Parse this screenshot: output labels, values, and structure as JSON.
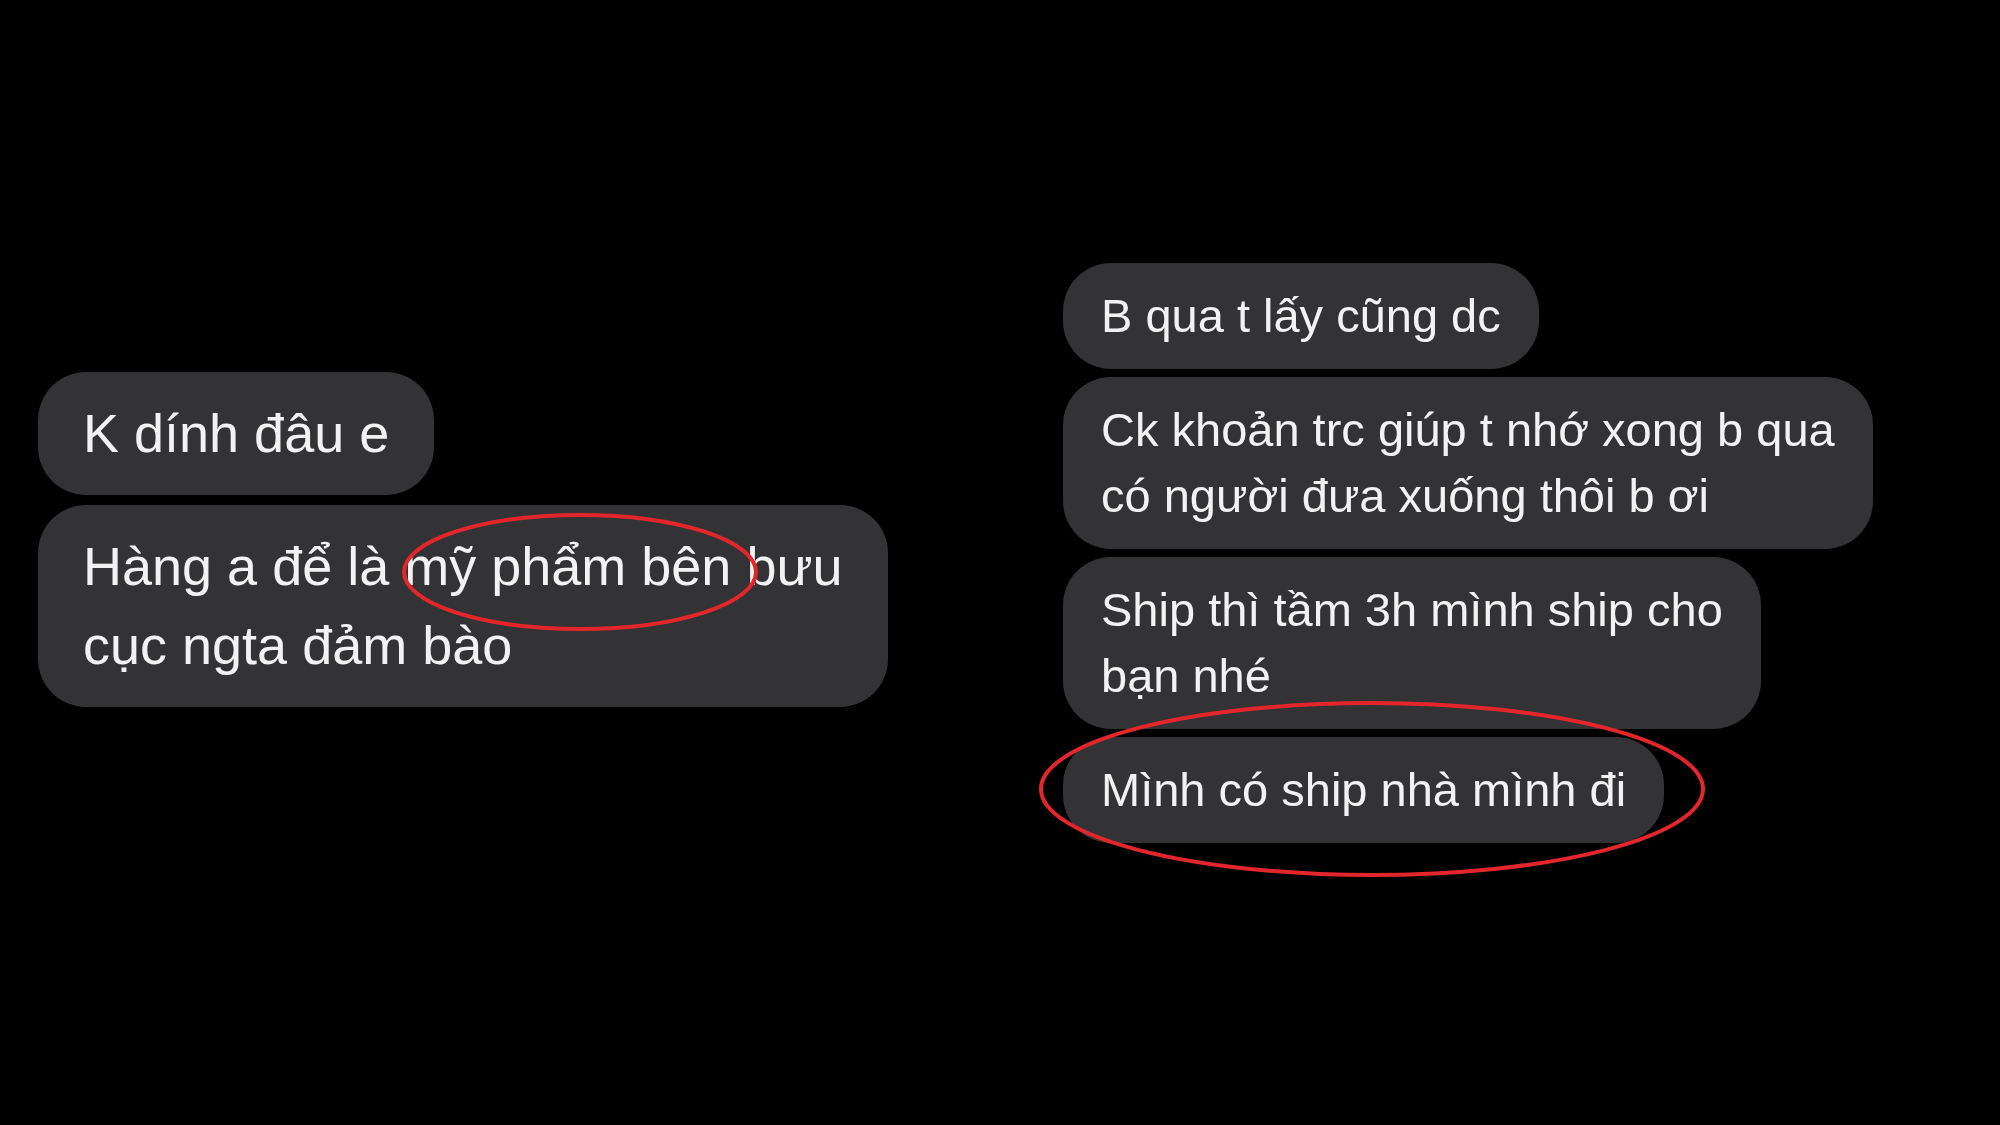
{
  "left_messages": [
    {
      "text": "K dính đâu e",
      "circled": false
    },
    {
      "text": "Hàng a để là mỹ phẩm bên bưu\ncục ngta đảm bào",
      "circled": true
    }
  ],
  "right_messages": [
    {
      "text": "B qua t lấy cũng dc",
      "circled": false
    },
    {
      "text": "Ck khoản trc giúp t nhớ xong b qua\ncó người đưa xuống thôi b ơi",
      "circled": false
    },
    {
      "text": "Ship thì tầm 3h mình ship cho\nbạn nhé",
      "circled": false
    },
    {
      "text": "Mình có ship nhà mình đi",
      "circled": true
    }
  ]
}
